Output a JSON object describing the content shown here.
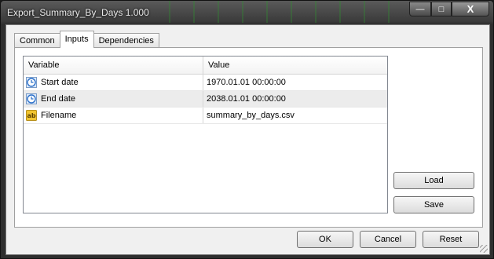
{
  "window": {
    "title": "Export_Summary_By_Days 1.000",
    "controls": {
      "minimize": "—",
      "maximize": "□",
      "close": "X"
    }
  },
  "tabs": [
    {
      "label": "Common",
      "active": false
    },
    {
      "label": "Inputs",
      "active": true
    },
    {
      "label": "Dependencies",
      "active": false
    }
  ],
  "table": {
    "headers": {
      "variable": "Variable",
      "value": "Value"
    },
    "rows": [
      {
        "icon": "clock-icon",
        "variable": "Start date",
        "value": "1970.01.01 00:00:00"
      },
      {
        "icon": "clock-icon",
        "variable": "End date",
        "value": "2038.01.01 00:00:00"
      },
      {
        "icon": "text-ab-icon",
        "variable": "Filename",
        "value": "summary_by_days.csv"
      }
    ]
  },
  "buttons": {
    "load": "Load",
    "save": "Save",
    "ok": "OK",
    "cancel": "Cancel",
    "reset": "Reset"
  },
  "colors": {
    "title_bar": "#3b3b3b",
    "clock_icon": "#2a6fc9",
    "ab_icon": "#f2c530",
    "alt_row": "#ececec"
  }
}
